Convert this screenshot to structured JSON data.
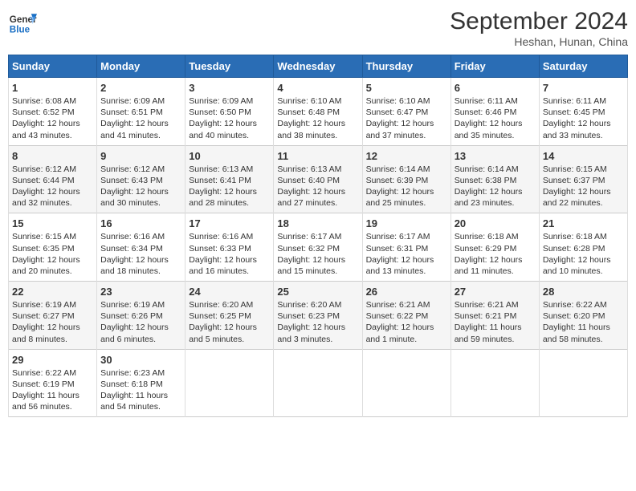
{
  "header": {
    "logo_general": "General",
    "logo_blue": "Blue",
    "month": "September 2024",
    "location": "Heshan, Hunan, China"
  },
  "weekdays": [
    "Sunday",
    "Monday",
    "Tuesday",
    "Wednesday",
    "Thursday",
    "Friday",
    "Saturday"
  ],
  "weeks": [
    [
      {
        "day": "1",
        "sunrise": "6:08 AM",
        "sunset": "6:52 PM",
        "daylight": "12 hours and 43 minutes."
      },
      {
        "day": "2",
        "sunrise": "6:09 AM",
        "sunset": "6:51 PM",
        "daylight": "12 hours and 41 minutes."
      },
      {
        "day": "3",
        "sunrise": "6:09 AM",
        "sunset": "6:50 PM",
        "daylight": "12 hours and 40 minutes."
      },
      {
        "day": "4",
        "sunrise": "6:10 AM",
        "sunset": "6:48 PM",
        "daylight": "12 hours and 38 minutes."
      },
      {
        "day": "5",
        "sunrise": "6:10 AM",
        "sunset": "6:47 PM",
        "daylight": "12 hours and 37 minutes."
      },
      {
        "day": "6",
        "sunrise": "6:11 AM",
        "sunset": "6:46 PM",
        "daylight": "12 hours and 35 minutes."
      },
      {
        "day": "7",
        "sunrise": "6:11 AM",
        "sunset": "6:45 PM",
        "daylight": "12 hours and 33 minutes."
      }
    ],
    [
      {
        "day": "8",
        "sunrise": "6:12 AM",
        "sunset": "6:44 PM",
        "daylight": "12 hours and 32 minutes."
      },
      {
        "day": "9",
        "sunrise": "6:12 AM",
        "sunset": "6:43 PM",
        "daylight": "12 hours and 30 minutes."
      },
      {
        "day": "10",
        "sunrise": "6:13 AM",
        "sunset": "6:41 PM",
        "daylight": "12 hours and 28 minutes."
      },
      {
        "day": "11",
        "sunrise": "6:13 AM",
        "sunset": "6:40 PM",
        "daylight": "12 hours and 27 minutes."
      },
      {
        "day": "12",
        "sunrise": "6:14 AM",
        "sunset": "6:39 PM",
        "daylight": "12 hours and 25 minutes."
      },
      {
        "day": "13",
        "sunrise": "6:14 AM",
        "sunset": "6:38 PM",
        "daylight": "12 hours and 23 minutes."
      },
      {
        "day": "14",
        "sunrise": "6:15 AM",
        "sunset": "6:37 PM",
        "daylight": "12 hours and 22 minutes."
      }
    ],
    [
      {
        "day": "15",
        "sunrise": "6:15 AM",
        "sunset": "6:35 PM",
        "daylight": "12 hours and 20 minutes."
      },
      {
        "day": "16",
        "sunrise": "6:16 AM",
        "sunset": "6:34 PM",
        "daylight": "12 hours and 18 minutes."
      },
      {
        "day": "17",
        "sunrise": "6:16 AM",
        "sunset": "6:33 PM",
        "daylight": "12 hours and 16 minutes."
      },
      {
        "day": "18",
        "sunrise": "6:17 AM",
        "sunset": "6:32 PM",
        "daylight": "12 hours and 15 minutes."
      },
      {
        "day": "19",
        "sunrise": "6:17 AM",
        "sunset": "6:31 PM",
        "daylight": "12 hours and 13 minutes."
      },
      {
        "day": "20",
        "sunrise": "6:18 AM",
        "sunset": "6:29 PM",
        "daylight": "12 hours and 11 minutes."
      },
      {
        "day": "21",
        "sunrise": "6:18 AM",
        "sunset": "6:28 PM",
        "daylight": "12 hours and 10 minutes."
      }
    ],
    [
      {
        "day": "22",
        "sunrise": "6:19 AM",
        "sunset": "6:27 PM",
        "daylight": "12 hours and 8 minutes."
      },
      {
        "day": "23",
        "sunrise": "6:19 AM",
        "sunset": "6:26 PM",
        "daylight": "12 hours and 6 minutes."
      },
      {
        "day": "24",
        "sunrise": "6:20 AM",
        "sunset": "6:25 PM",
        "daylight": "12 hours and 5 minutes."
      },
      {
        "day": "25",
        "sunrise": "6:20 AM",
        "sunset": "6:23 PM",
        "daylight": "12 hours and 3 minutes."
      },
      {
        "day": "26",
        "sunrise": "6:21 AM",
        "sunset": "6:22 PM",
        "daylight": "12 hours and 1 minute."
      },
      {
        "day": "27",
        "sunrise": "6:21 AM",
        "sunset": "6:21 PM",
        "daylight": "11 hours and 59 minutes."
      },
      {
        "day": "28",
        "sunrise": "6:22 AM",
        "sunset": "6:20 PM",
        "daylight": "11 hours and 58 minutes."
      }
    ],
    [
      {
        "day": "29",
        "sunrise": "6:22 AM",
        "sunset": "6:19 PM",
        "daylight": "11 hours and 56 minutes."
      },
      {
        "day": "30",
        "sunrise": "6:23 AM",
        "sunset": "6:18 PM",
        "daylight": "11 hours and 54 minutes."
      },
      null,
      null,
      null,
      null,
      null
    ]
  ]
}
